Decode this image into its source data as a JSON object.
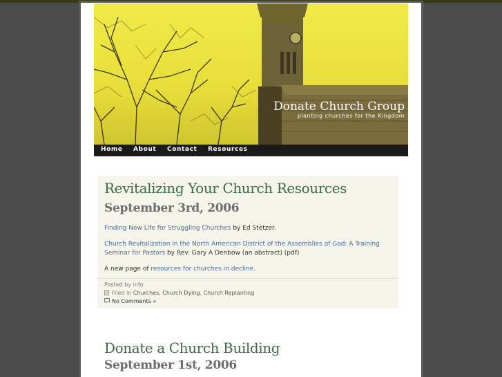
{
  "site": {
    "title": "Donate Church Group",
    "tagline": "planting churches for the Kingdom"
  },
  "nav": {
    "items": [
      {
        "label": "Home"
      },
      {
        "label": "About"
      },
      {
        "label": "Contact"
      },
      {
        "label": "Resources"
      }
    ]
  },
  "posts": [
    {
      "title": "Revitalizing Your Church Resources",
      "date": "September 3rd, 2006",
      "entry": {
        "p1_link": "Finding New Life for Struggling Churches",
        "p1_text": " by Ed Stetzer.",
        "p2_link_line1": "Church Revitalization in the North American District of the Assemblies of God: A Training",
        "p2_link_line2": "Seminar for Pastors",
        "p2_text": " by Rev. Gary A Denbow (an abstract) (pdf)",
        "p3_text_before": "A new page of ",
        "p3_link": "resources for churches in decline",
        "p3_text_after": "."
      },
      "meta": {
        "posted_by": "Posted by info",
        "filed_in_label": "Filed in ",
        "categories": [
          "Churches",
          "Church Dying",
          "Church Replanting"
        ],
        "category_sep": ", ",
        "comments": "No Comments »"
      }
    },
    {
      "title": "Donate a Church Building",
      "date": "September 1st, 2006"
    }
  ],
  "colors": {
    "header_yellow": "#ecE246",
    "title_green": "#3e6b4d",
    "link_blue": "#4a6a9a",
    "nav_bg": "#1a1a1a"
  }
}
